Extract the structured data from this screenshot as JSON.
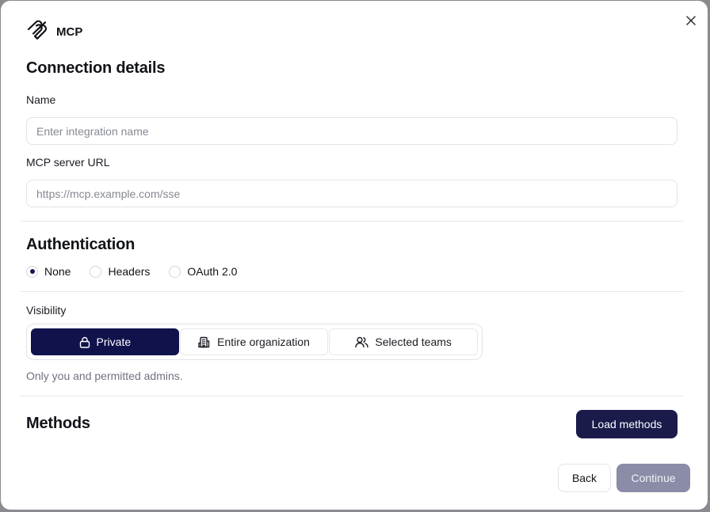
{
  "brand": {
    "name": "MCP",
    "icon": "mcp-logo-icon"
  },
  "close": {
    "icon": "close-icon"
  },
  "connection": {
    "title": "Connection details",
    "name_label": "Name",
    "name_placeholder": "Enter integration name",
    "name_value": "",
    "url_label": "MCP server URL",
    "url_placeholder": "https://mcp.example.com/sse",
    "url_value": ""
  },
  "authentication": {
    "title": "Authentication",
    "options": [
      {
        "label": "None",
        "selected": true
      },
      {
        "label": "Headers",
        "selected": false
      },
      {
        "label": "OAuth 2.0",
        "selected": false
      }
    ]
  },
  "visibility": {
    "label": "Visibility",
    "options": [
      {
        "label": "Private",
        "icon": "lock-icon",
        "selected": true
      },
      {
        "label": "Entire organization",
        "icon": "building-icon",
        "selected": false
      },
      {
        "label": "Selected teams",
        "icon": "users-icon",
        "selected": false
      }
    ],
    "helper": "Only you and permitted admins."
  },
  "methods": {
    "title": "Methods",
    "load_label": "Load methods"
  },
  "footer": {
    "back_label": "Back",
    "continue_label": "Continue"
  },
  "colors": {
    "primary": "#0f124b",
    "primary_button": "#1a1b4b",
    "disabled_button": "#8b8ca8",
    "border": "#e2e3e8",
    "muted_text": "#6f7280"
  }
}
